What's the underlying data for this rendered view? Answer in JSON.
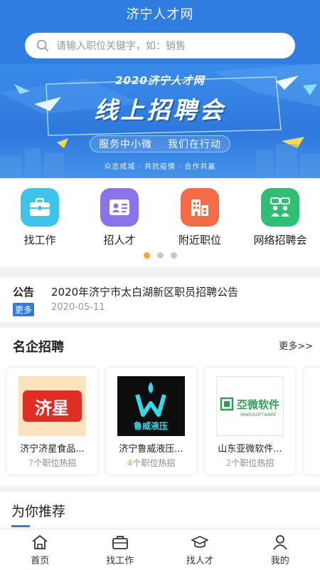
{
  "app": {
    "title": "济宁人才网"
  },
  "search": {
    "placeholder": "请输入职位关键字，如：销售"
  },
  "banner": {
    "year_line": "2020济宁人才网",
    "headline": "线上招聘会",
    "slogan_left": "服务中小微",
    "slogan_right": "我们在行动",
    "footer": "众志成城 · 共抗疫情 · 合作共赢"
  },
  "quick_menu": [
    {
      "label": "找工作",
      "icon": "briefcase-icon",
      "color": "#3ec4e8"
    },
    {
      "label": "招人才",
      "icon": "id-card-icon",
      "color": "#8a73e8"
    },
    {
      "label": "附近职位",
      "icon": "building-icon",
      "color": "#f36b47"
    },
    {
      "label": "网络招聘会",
      "icon": "people-chat-icon",
      "color": "#2fbf74"
    }
  ],
  "carousel": {
    "pages": 3,
    "active": 1
  },
  "notice": {
    "tag": "公告",
    "more": "更多",
    "title": "2020年济宁市太白湖新区职员招聘公告",
    "date": "2020-05-11"
  },
  "companies": {
    "title": "名企招聘",
    "more": "更多>>",
    "items": [
      {
        "name": "济宁济星食品...",
        "jobs_num": "7",
        "jobs_suffix": "个职位热招",
        "logo_text": "济星"
      },
      {
        "name": "济宁鲁威液压...",
        "jobs_num": "4",
        "jobs_suffix": "个职位热招",
        "logo_text": "鲁威液压"
      },
      {
        "name": "山东亚微软件...",
        "jobs_num": "2",
        "jobs_suffix": "个职位热招",
        "logo_text": "亞微软件",
        "logo_subtext": "YAWEISOFTWARE"
      }
    ]
  },
  "recommend": {
    "title": "为你推荐"
  },
  "tabbar": [
    {
      "label": "首页",
      "icon": "home-icon"
    },
    {
      "label": "找工作",
      "icon": "briefcase-icon"
    },
    {
      "label": "找人才",
      "icon": "graduation-cap-icon"
    },
    {
      "label": "我的",
      "icon": "user-icon"
    }
  ],
  "colors": {
    "primary": "#2f7de1",
    "accent": "#f5a623"
  }
}
